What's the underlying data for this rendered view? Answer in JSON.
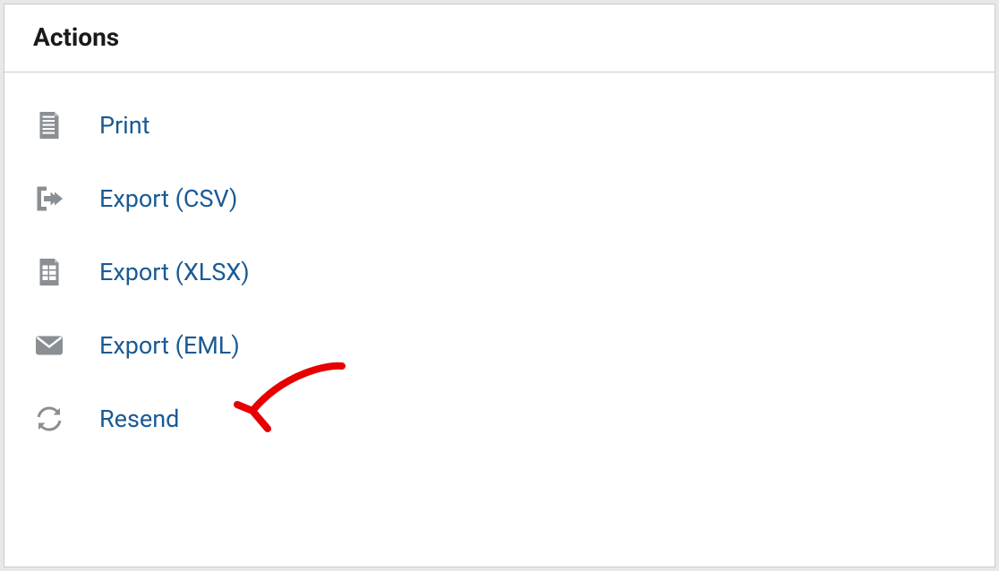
{
  "panel": {
    "title": "Actions"
  },
  "actions": {
    "print": {
      "label": "Print",
      "icon": "document-icon"
    },
    "export_csv": {
      "label": "Export (CSV)",
      "icon": "export-arrow-icon"
    },
    "export_xlsx": {
      "label": "Export (XLSX)",
      "icon": "spreadsheet-icon"
    },
    "export_eml": {
      "label": "Export (EML)",
      "icon": "envelope-icon"
    },
    "resend": {
      "label": "Resend",
      "icon": "refresh-icon"
    }
  },
  "annotation": {
    "type": "hand-drawn-arrow",
    "color": "#e60000",
    "target": "resend"
  }
}
